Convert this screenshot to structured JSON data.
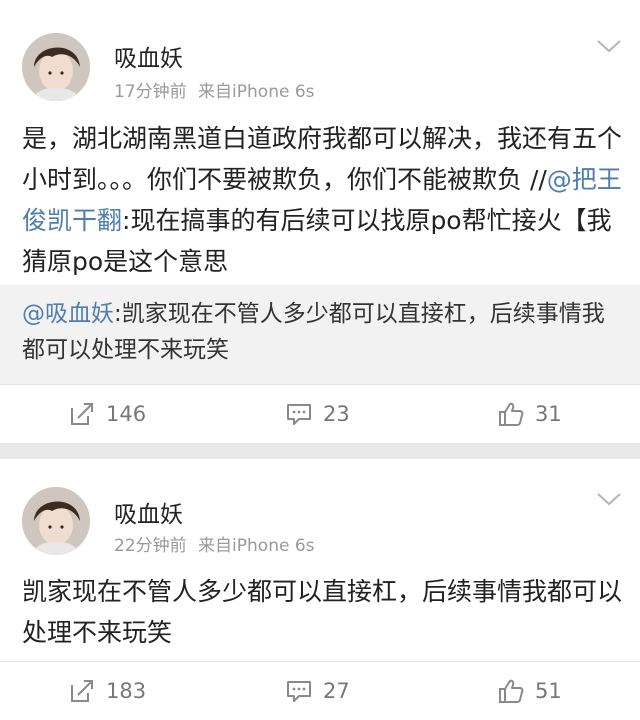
{
  "posts": [
    {
      "username": "吸血妖",
      "time": "17分钟前",
      "source": "来自iPhone 6s",
      "content_part1": "是，湖北湖南黑道白道政府我都可以解决，我还有五个小时到。。。你们不要被欺负，你们不能被欺负 //",
      "content_mention": "@把王俊凯干翻",
      "content_part2": ":现在搞事的有后续可以找原po帮忙接火【我猜原po是这个意思",
      "repost_mention": "@吸血妖",
      "repost_text": ":凯家现在不管人多少都可以直接杠，后续事情我都可以处理不来玩笑",
      "reposts": "146",
      "comments": "23",
      "likes": "31"
    },
    {
      "username": "吸血妖",
      "time": "22分钟前",
      "source": "来自iPhone 6s",
      "content": "凯家现在不管人多少都可以直接杠，后续事情我都可以处理不来玩笑",
      "reposts": "183",
      "comments": "27",
      "likes": "51"
    }
  ],
  "icons": {
    "repost": "share-icon",
    "comment": "comment-icon",
    "like": "thumbs-up-icon",
    "menu": "chevron-down-icon"
  },
  "colors": {
    "mention": "#507daf",
    "meta": "#9a9a9a",
    "background": "#e9e9e9"
  }
}
